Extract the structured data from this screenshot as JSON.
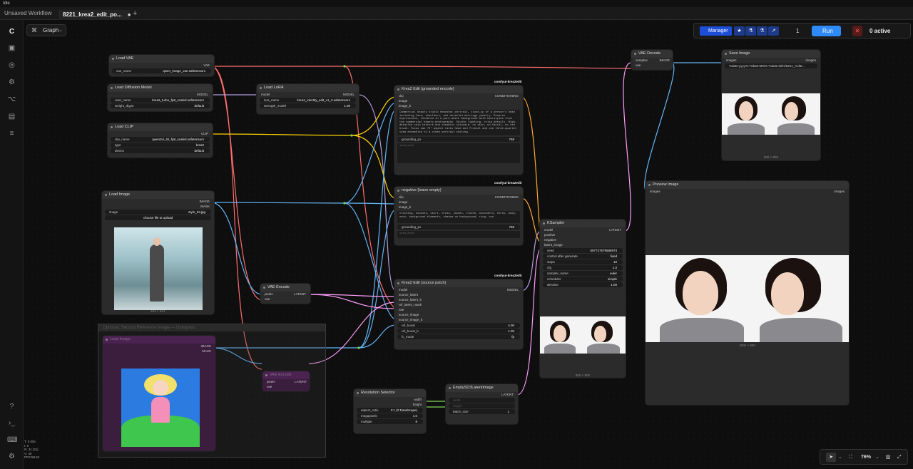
{
  "window": {
    "title": "Idle"
  },
  "tabs": [
    {
      "label": "Unsaved Workflow"
    },
    {
      "label": "8221_krea2_edit_po...",
      "dot": "●"
    }
  ],
  "tab_add": "+",
  "view_mode": "Graph",
  "toolbar": {
    "manager_label": "Manager",
    "run_count": "1",
    "run_label": "Run",
    "active_label": "0 active"
  },
  "nodes": {
    "load_vae": {
      "title": "Load VAE",
      "out": "VAE",
      "w_name": "vae_name",
      "w_val": "qwen_image_vae.safetensors"
    },
    "load_diff": {
      "title": "Load Diffusion Model",
      "out": "MODEL",
      "w1_name": "unet_name",
      "w1_val": "krea2_turbo_fp8_scaled.safetensors",
      "w2_name": "weight_dtype",
      "w2_val": "default"
    },
    "load_clip": {
      "title": "Load CLIP",
      "out": "CLIP",
      "w1_name": "clip_name",
      "w1_val": "qwen3vl_4b_fp8_scaled.safetensors",
      "w2_name": "type",
      "w2_val": "krea2",
      "w3_name": "device",
      "w3_val": "default"
    },
    "load_image": {
      "title": "Load Image",
      "out1": "IMAGE",
      "out2": "MASK",
      "w_name": "image",
      "w_val": "style_03.jpg",
      "upload": "choose file to upload",
      "dims": "512 × 512"
    },
    "load_lora": {
      "title": "Load LoRA",
      "in": "model",
      "out": "MODEL",
      "w1_name": "lora_name",
      "w1_val": "krea2_identity_edit_v1_3.safetensors",
      "w2_name": "strength_model",
      "w2_val": "1.00"
    },
    "vae_encode": {
      "title": "VAE Encode",
      "in1": "pixels",
      "in2": "vae",
      "out": "LATENT"
    },
    "krea_pos": {
      "title": "Krea2 Edit (grounded encode)",
      "badge": "comfyui-krea2edit",
      "in1": "clip",
      "in2": "image",
      "in3": "image_b",
      "out": "CONDITIONING",
      "text": "Commercial beauty studio headshot portrait, close-up of a person's head including face, shoulders, and detailed earrings jewelry. Diverse expressions, rendered in a pure white background with hairstyles from the commercial beauty photography. Studio lighting, crisp details. High-detailed skin texture and cosmetic skincare, no skin, no facial, no red blush. Focus two 75° aspect rates head and frontal and one three-quarter view ensembled to a clean portrait setting.",
      "w_name": "grounding_px",
      "w_val": "768",
      "placeholder": "seed_mode"
    },
    "krea_neg": {
      "title": "negative (leave empty)",
      "badge": "comfyui-krea2edit",
      "in1": "clip",
      "in2": "image",
      "in3": "image_b",
      "out": "CONDITIONING",
      "text": "clothing, cookies, skirt, dress, jacket, clothe, shoulders, torso, body, neck, background elements, shadow on background, ring, sun",
      "w_name": "grounding_px",
      "w_val": "768",
      "placeholder": "seed_mode"
    },
    "krea_src": {
      "title": "Krea2 Edit (source patch)",
      "badge": "comfyui-krea2edit",
      "out": "MODEL",
      "ins": [
        "model",
        "source_latent",
        "source_latent_b",
        "ref_latent_mask",
        "vae",
        "source_image",
        "source_image_b"
      ],
      "w1_name": "ref_boost",
      "w1_val": "4.00",
      "w2_name": "ref_boost_b",
      "w2_val": "1.00",
      "w3_name": "fc_mode",
      "w3_val": "fp"
    },
    "ksampler": {
      "title": "KSampler",
      "ins": [
        "model",
        "positive",
        "negative",
        "latent_image"
      ],
      "out": "LATENT",
      "w": [
        [
          "seed",
          "597747679586973"
        ],
        [
          "control after generate",
          "fixed"
        ],
        [
          "steps",
          "10"
        ],
        [
          "cfg",
          "1.0"
        ],
        [
          "sampler_name",
          "euler"
        ],
        [
          "scheduler",
          "simple"
        ],
        [
          "denoise",
          "1.00"
        ]
      ],
      "dims": "800 × 800"
    },
    "vae_decode": {
      "title": "VAE Decode",
      "in1": "samples",
      "in2": "vae",
      "out": "IMAGE"
    },
    "save_image": {
      "title": "Save Image",
      "in": "images",
      "out": "images",
      "w_val": "%date:yyyy%-%date:MM%-%date:dd%/8221_%dat...",
      "dims": "800 × 800"
    },
    "preview": {
      "title": "Preview Image",
      "in": "images",
      "out": "images",
      "dims": "1600 × 800"
    },
    "res_sel": {
      "title": "Resolution Selector",
      "out1": "width",
      "out2": "height",
      "w": [
        [
          "aspect_ratio",
          "2:1 (2:1landscape)"
        ],
        [
          "megapixels",
          "1.0"
        ],
        [
          "multiple",
          "8"
        ]
      ]
    },
    "empty_latent": {
      "title": "EmptySD3LatentImage",
      "out": "LATENT",
      "p1": "width",
      "p2": "height",
      "w_name": "batch_size",
      "w_val": "1"
    },
    "group": {
      "title": "Optional: Second Reference Image — Unbypass"
    },
    "load_image2": {
      "title": "Load Image",
      "out1": "IMAGE",
      "out2": "MASK"
    },
    "vae_encode2": {
      "title": "VAE Encode",
      "in1": "pixels",
      "in2": "vae",
      "out": "LATENT"
    }
  },
  "stats": [
    "T: 0.00s",
    "I: 0",
    "N: 31 [31]",
    "V: 40",
    "FPS:59.52"
  ],
  "zoom": "76%",
  "colors": {
    "vae": "#ff6e6e",
    "model": "#b39ddb",
    "clip": "#ffd500",
    "image": "#64b5f6",
    "latent": "#ff9cf9",
    "conditioning": "#ffa931",
    "int": "#7ed957",
    "accent": "#2f8af5"
  },
  "icons": [
    "comfy-logo-icon",
    "images-icon",
    "model-library-icon",
    "node-library-icon",
    "workflows-icon",
    "templates-icon",
    "queue-icon",
    "help-icon",
    "terminal-icon",
    "keyboard-icon",
    "settings-icon"
  ]
}
